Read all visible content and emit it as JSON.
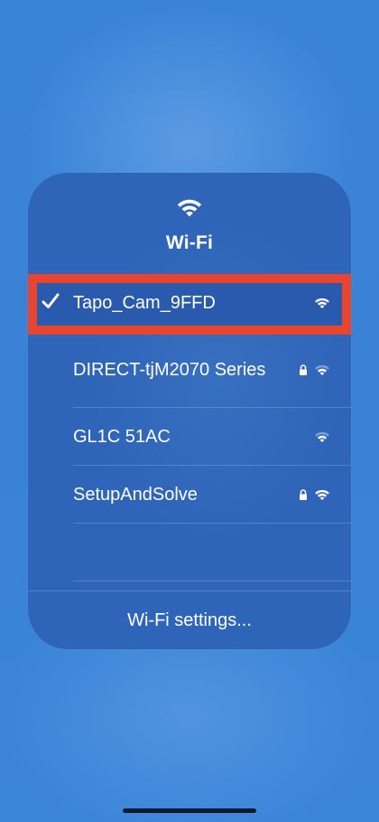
{
  "header": {
    "title": "Wi-Fi",
    "icon": "wifi-icon"
  },
  "networks": [
    {
      "name": "Tapo_Cam_9FFD",
      "connected": true,
      "secured": false,
      "signal": "full"
    },
    {
      "name": "DIRECT-tjM2070 Series",
      "connected": false,
      "secured": true,
      "signal": "medium"
    },
    {
      "name": "GL1C 51AC",
      "connected": false,
      "secured": false,
      "signal": "medium"
    },
    {
      "name": "SetupAndSolve",
      "connected": false,
      "secured": true,
      "signal": "full"
    }
  ],
  "footer": {
    "settings_label": "Wi-Fi settings..."
  },
  "colors": {
    "background": "#3a84d8",
    "panel": "#2f65b8",
    "highlight": "#e8442e"
  }
}
